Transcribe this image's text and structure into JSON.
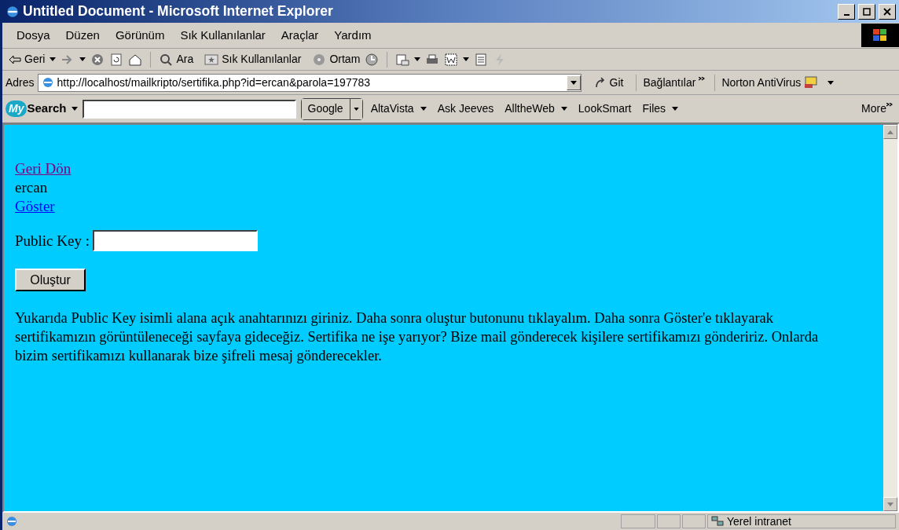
{
  "window": {
    "title": "Untitled Document - Microsoft Internet Explorer"
  },
  "menu": [
    "Dosya",
    "Düzen",
    "Görünüm",
    "Sık Kullanılanlar",
    "Araçlar",
    "Yardım"
  ],
  "toolbar": {
    "back": "Geri",
    "search": "Ara",
    "favorites": "Sık Kullanılanlar",
    "media": "Ortam"
  },
  "address_bar": {
    "label": "Adres",
    "url": "http://localhost/mailkripto/sertifika.php?id=ercan&parola=197783",
    "go": "Git",
    "links": "Bağlantılar",
    "norton": "Norton AntiVirus"
  },
  "search_bar": {
    "logo_my": "My",
    "logo_search": "Search",
    "engine": "Google",
    "items": [
      {
        "label": "AltaVista",
        "dropdown": true
      },
      {
        "label": "Ask Jeeves",
        "dropdown": false
      },
      {
        "label": "AlltheWeb",
        "dropdown": true
      },
      {
        "label": "LookSmart",
        "dropdown": false
      },
      {
        "label": "Files",
        "dropdown": true
      }
    ],
    "more": "More"
  },
  "page": {
    "links_top": [
      {
        "label": "Geri Dön",
        "visited": true
      }
    ],
    "user": "ercan",
    "links_bottom": [
      {
        "label": "Göster",
        "visited": false
      }
    ],
    "field_label": "Public Key :",
    "button": "Oluştur",
    "paragraph": "Yukarıda Public Key isimli alana açık anahtarınızı giriniz. Daha sonra oluştur butonunu tıklayalım. Daha sonra Göster'e tıklayarak sertifikamızın görüntüleneceği sayfaya gideceğiz. Sertifika ne işe yarıyor? Bize mail gönderecek kişilere sertifikamızı göndeririz. Onlarda bizim sertifikamızı kullanarak bize şifreli mesaj gönderecekler."
  },
  "status_bar": {
    "zone": "Yerel intranet"
  }
}
